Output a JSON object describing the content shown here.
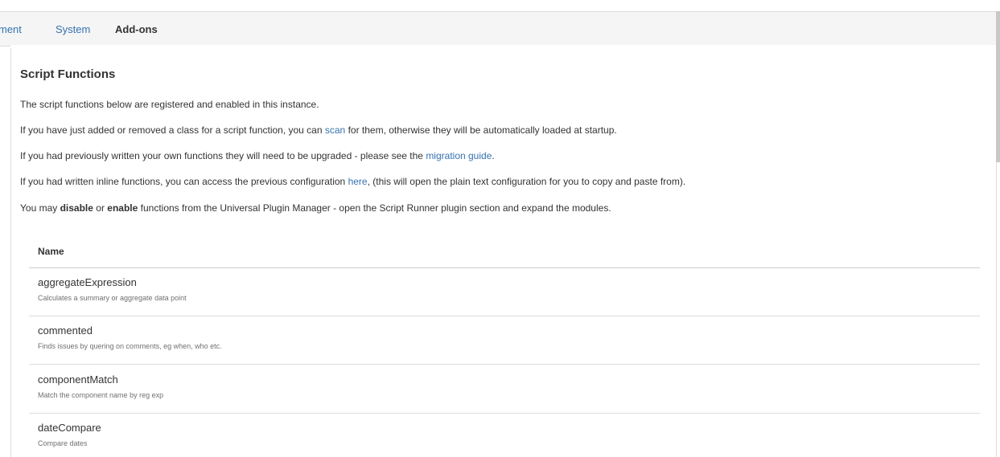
{
  "tabs": [
    {
      "label": "ment",
      "active": false
    },
    {
      "label": "System",
      "active": false
    },
    {
      "label": "Add-ons",
      "active": true
    }
  ],
  "section": {
    "title": "Script Functions",
    "p1": "The script functions below are registered and enabled in this instance.",
    "p2_before": "If you have just added or removed a class for a script function, you can ",
    "p2_link": "scan",
    "p2_after": " for them, otherwise they will be automatically loaded at startup.",
    "p3_before": "If you had previously written your own functions they will need to be upgraded - please see the ",
    "p3_link": "migration guide",
    "p3_after": ".",
    "p4_before": "If you had written inline functions, you can access the previous configuration ",
    "p4_link": "here",
    "p4_after": ",  (this will open the plain text configuration for you to copy and paste from).",
    "p5_before": "You may ",
    "p5_bold1": "disable",
    "p5_mid": " or ",
    "p5_bold2": "enable",
    "p5_after": " functions from the Universal Plugin Manager - open the Script Runner plugin section and expand the modules."
  },
  "table": {
    "column_name": "Name",
    "rows": [
      {
        "name": "aggregateExpression",
        "desc": "Calculates a summary or aggregate data point"
      },
      {
        "name": "commented",
        "desc": "Finds issues by quering on comments, eg when, who etc."
      },
      {
        "name": "componentMatch",
        "desc": "Match the component name by reg exp"
      },
      {
        "name": "dateCompare",
        "desc": "Compare dates"
      }
    ]
  },
  "colors": {
    "link": "#3572b0",
    "text": "#333333",
    "muted": "#707070",
    "border": "#dddddd",
    "tab_bar_bg": "#f5f5f5"
  }
}
